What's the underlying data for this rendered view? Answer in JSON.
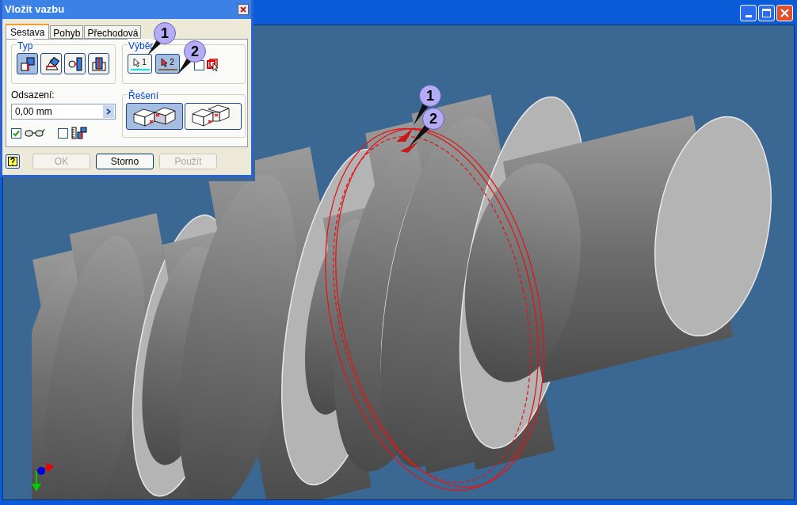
{
  "dialog": {
    "title": "Vložit vazbu",
    "tabs": [
      {
        "label": "Sestava",
        "selected": true
      },
      {
        "label": "Pohyb",
        "selected": false
      },
      {
        "label": "Přechodová",
        "selected": false
      }
    ],
    "type_group": {
      "label": "Typ",
      "options": [
        {
          "kind": "mate",
          "selected": true
        },
        {
          "kind": "angle",
          "selected": false
        },
        {
          "kind": "tangent",
          "selected": false
        },
        {
          "kind": "insert",
          "selected": false
        }
      ]
    },
    "selection_group": {
      "label": "Výběr",
      "buttons": [
        {
          "label": "1",
          "selected": false,
          "color": "#00e8f0"
        },
        {
          "label": "2",
          "selected": true,
          "color": "#7a6a40"
        }
      ],
      "first_occurrence_checked": false
    },
    "offset": {
      "label": "Odsazení:",
      "value": "0,00 mm"
    },
    "preview_checked": true,
    "predict_offset_checked": false,
    "solution_group": {
      "label": "Řešení",
      "options": [
        {
          "kind": "mate",
          "selected": true
        },
        {
          "kind": "flush",
          "selected": false
        }
      ]
    },
    "buttons": [
      {
        "label": "OK",
        "disabled": true
      },
      {
        "label": "Storno",
        "disabled": false
      },
      {
        "label": "Použít",
        "disabled": true
      }
    ]
  },
  "callouts": [
    {
      "label": "1"
    },
    {
      "label": "2"
    },
    {
      "label": "1"
    },
    {
      "label": "2"
    }
  ]
}
